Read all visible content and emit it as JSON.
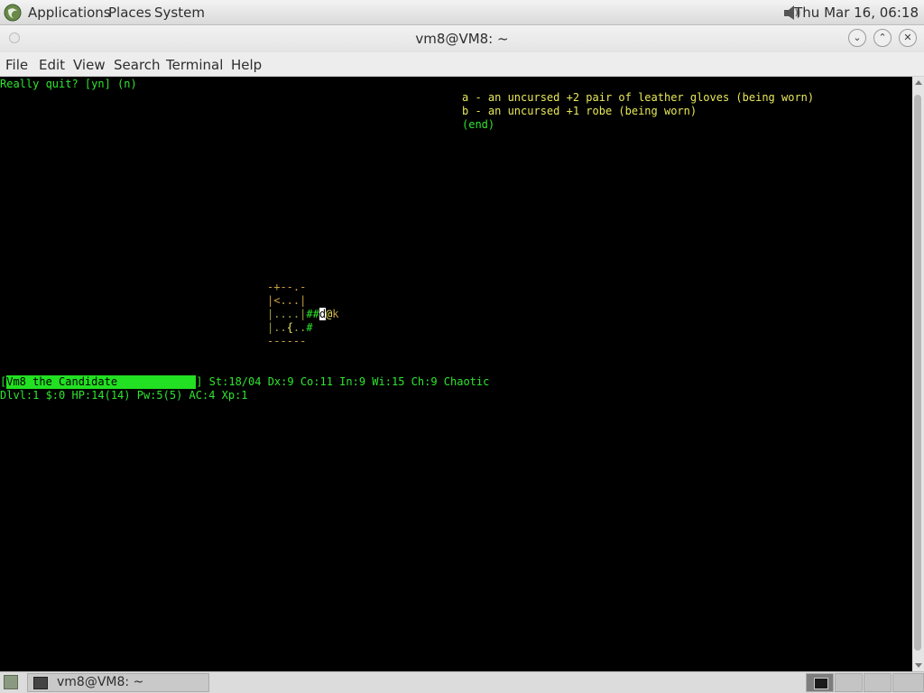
{
  "top_panel": {
    "menus": [
      "Applications",
      "Places",
      "System"
    ],
    "clock": "Thu Mar 16, 06:18",
    "logo_icon": "mate-logo-icon",
    "volume_icon": "speaker-icon"
  },
  "window": {
    "title": "vm8@VM8: ~",
    "controls": [
      "minimize",
      "maximize",
      "close"
    ]
  },
  "menubar": {
    "items": [
      "File",
      "Edit",
      "View",
      "Search",
      "Terminal",
      "Help"
    ]
  },
  "terminal": {
    "prompt": "Really quit? [yn] (n)",
    "inventory": [
      "a - an uncursed +2 pair of leather gloves (being worn)",
      "b - an uncursed +1 robe (being worn)",
      "(end)"
    ],
    "map": {
      "row1": "-+--.-",
      "row2_wall": "|<...|",
      "row3_room": "|....|",
      "row3_corridor": "##",
      "row3_dog": "d",
      "row3_player": "@",
      "row3_kobold": "k",
      "row4_a": "|..",
      "row4_fountain": "{",
      "row4_b": "..",
      "row4_corridor": "#",
      "row5": "------"
    },
    "status1": {
      "bracket_open": "[",
      "name": "Vm8 the Candidate",
      "rest": "] St:18/04 Dx:9 Co:11 In:9 Wi:15 Ch:9 Chaotic"
    },
    "status2": "Dlvl:1 $:0 HP:14(14) Pw:5(5) AC:4 Xp:1"
  },
  "taskbar": {
    "task_label": "vm8@VM8: ~",
    "workspaces": 4,
    "active_workspace": 1
  },
  "colors": {
    "terminal_bg": "#000000",
    "text_green": "#2fe52f",
    "text_yellow": "#e8e85a",
    "highlight_green": "#22e022"
  }
}
